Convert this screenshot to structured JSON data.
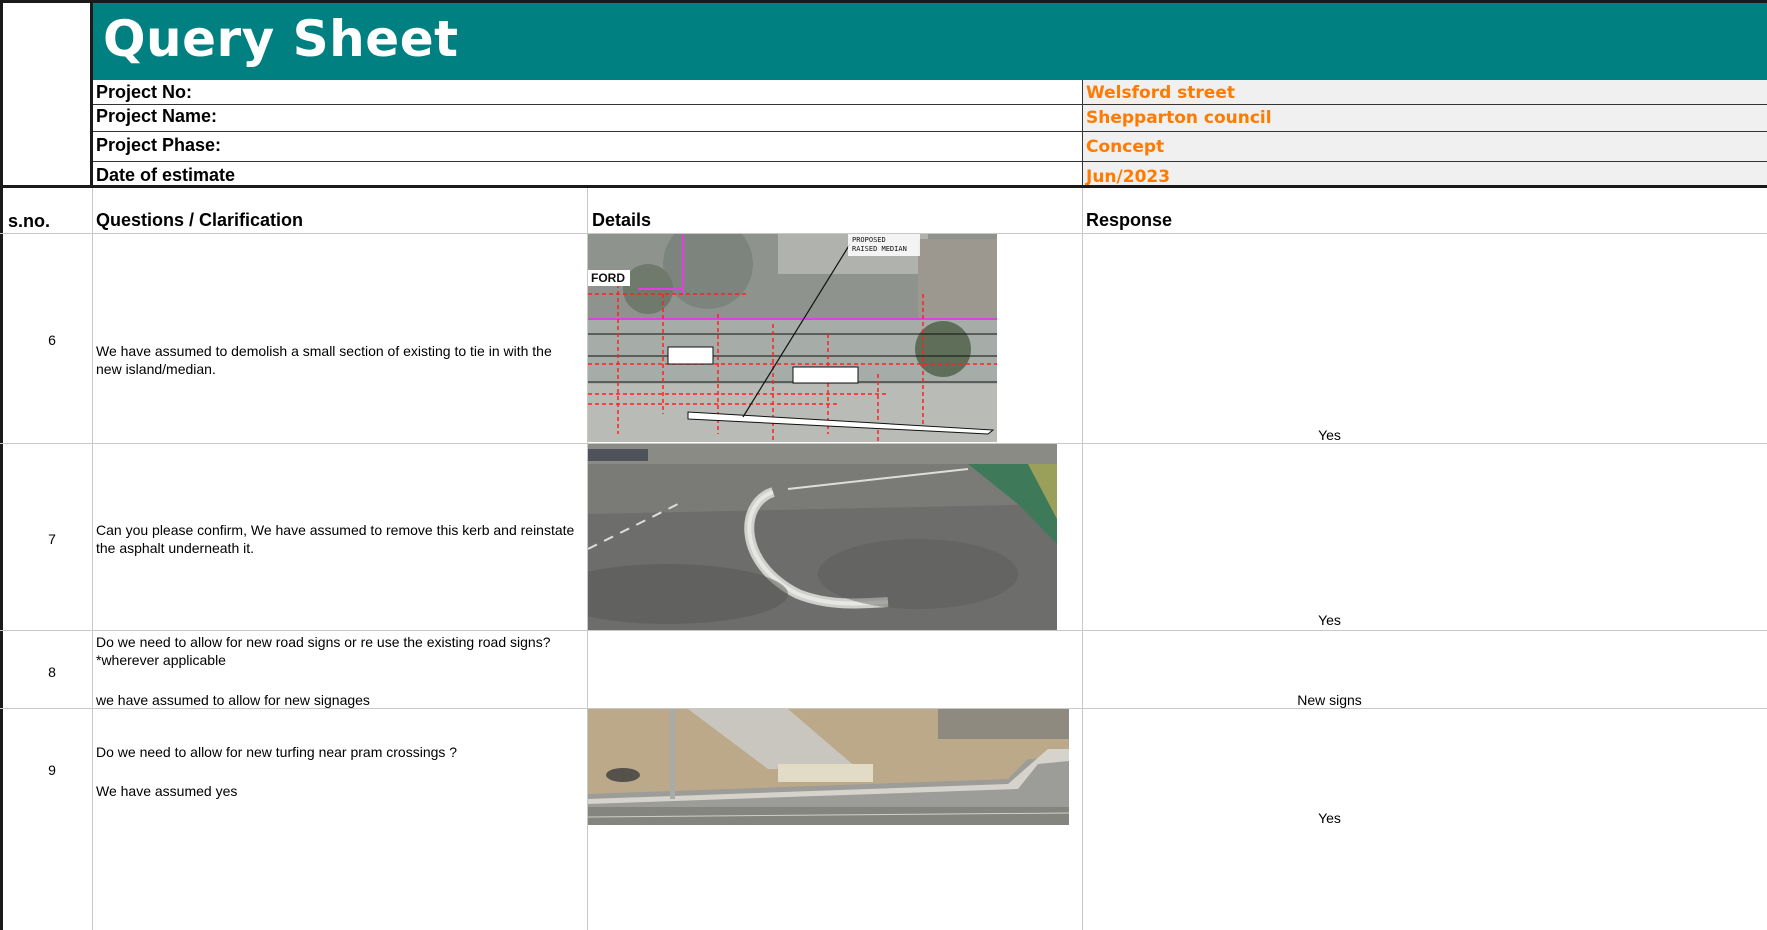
{
  "header": {
    "title": "Query Sheet"
  },
  "project_info": [
    {
      "label": "Project No:",
      "value": "Welsford street"
    },
    {
      "label": "Project Name:",
      "value": "Shepparton council"
    },
    {
      "label": "Project Phase:",
      "value": "Concept"
    },
    {
      "label": "Date of estimate",
      "value": "Jun/2023"
    }
  ],
  "table": {
    "columns": [
      "s.no.",
      "Questions / Clarification",
      "Details",
      "Response"
    ],
    "rows": [
      {
        "sno": "6",
        "question_lines": [
          "We have assumed to demolish a small section of existing to tie in with the new island/median."
        ],
        "image_label_1": "FORD",
        "image_label_2": "PROPOSED",
        "image_label_3": "RAISED MEDIAN",
        "response": "Yes"
      },
      {
        "sno": "7",
        "question_lines": [
          "Can you please confirm, We have assumed to remove this kerb and reinstate the asphalt underneath it."
        ],
        "response": "Yes"
      },
      {
        "sno": "8",
        "question_lines": [
          "Do we need to allow for new road signs or re use the existing road signs? *wherever applicable",
          "we have assumed to allow for new signages"
        ],
        "response": "New signs"
      },
      {
        "sno": "9",
        "question_lines": [
          "Do we need to allow for new turfing near pram crossings ?",
          "We have assumed yes"
        ],
        "response": "Yes"
      }
    ]
  }
}
